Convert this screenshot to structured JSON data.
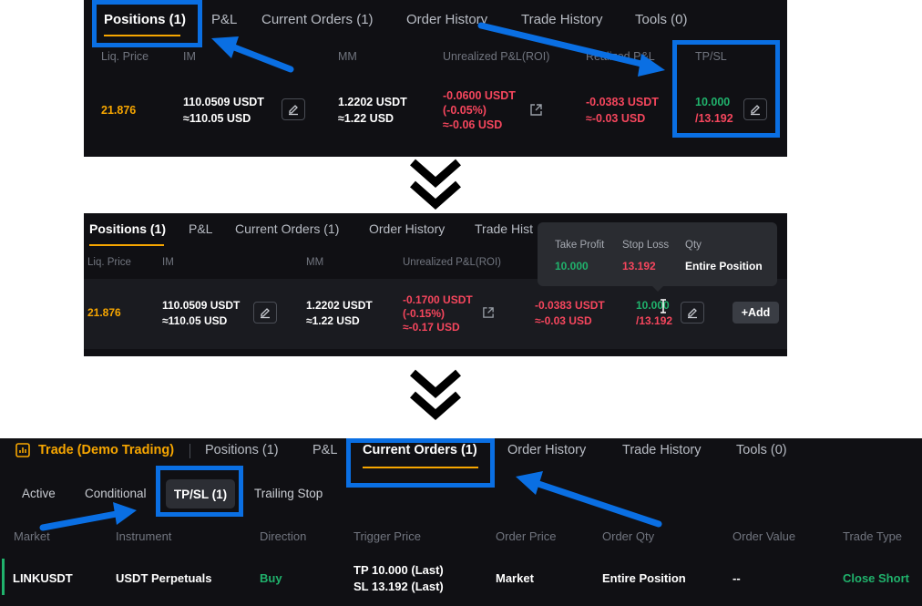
{
  "panel1": {
    "tabs": [
      "Positions (1)",
      "P&L",
      "Current Orders (1)",
      "Order History",
      "Trade History",
      "Tools (0)"
    ],
    "headers": {
      "liq": "Liq. Price",
      "im": "IM",
      "mm": "MM",
      "upnl": "Unrealized P&L(ROI)",
      "rpnl": "Realized P&L",
      "tpsl": "TP/SL"
    },
    "row": {
      "liq": "21.876",
      "im1": "110.0509 USDT",
      "im2": "≈110.05 USD",
      "mm1": "1.2202 USDT",
      "mm2": "≈1.22 USD",
      "upnl1": "-0.0600 USDT",
      "upnl2": "(-0.05%)",
      "upnl3": "≈-0.06 USD",
      "rpnl1": "-0.0383 USDT",
      "rpnl2": "≈-0.03 USD",
      "tp": "10.000",
      "sl": "/13.192"
    }
  },
  "panel2": {
    "tabs": [
      "Positions (1)",
      "P&L",
      "Current Orders (1)",
      "Order History",
      "Trade Hist"
    ],
    "headers": {
      "liq": "Liq. Price",
      "im": "IM",
      "mm": "MM",
      "upnl": "Unrealized P&L(ROI)"
    },
    "row": {
      "liq": "21.876",
      "im1": "110.0509 USDT",
      "im2": "≈110.05 USD",
      "mm1": "1.2202 USDT",
      "mm2": "≈1.22 USD",
      "upnl1": "-0.1700 USDT",
      "upnl2": "(-0.15%)",
      "upnl3": "≈-0.17 USD",
      "rpnl1": "-0.0383 USDT",
      "rpnl2": "≈-0.03 USD",
      "tp": "10.000",
      "sl": "/13.192",
      "add": "+Add"
    },
    "tooltip": {
      "h_tp": "Take Profit",
      "h_sl": "Stop Loss",
      "h_qty": "Qty",
      "tp": "10.000",
      "sl": "13.192",
      "qty": "Entire Position"
    }
  },
  "panel3": {
    "title": "Trade (Demo Trading)",
    "tabs": [
      "Positions (1)",
      "P&L",
      "Current Orders (1)",
      "Order History",
      "Trade History",
      "Tools (0)"
    ],
    "subtabs": [
      "Active",
      "Conditional",
      "TP/SL (1)",
      "Trailing Stop"
    ],
    "headers": [
      "Market",
      "Instrument",
      "Direction",
      "Trigger Price",
      "Order Price",
      "Order Qty",
      "Order Value",
      "Trade Type"
    ],
    "row": {
      "market": "LINKUSDT",
      "instrument": "USDT Perpetuals",
      "direction": "Buy",
      "trigger1": "TP 10.000 (Last)",
      "trigger2": "SL 13.192 (Last)",
      "price": "Market",
      "qty": "Entire Position",
      "value": "--",
      "type": "Close Short"
    }
  },
  "colors": {
    "accent": "#f7a600",
    "highlight": "#0a6fe3",
    "green": "#20b26c",
    "red": "#f6465d"
  },
  "icons": [
    "edit-icon",
    "share-icon",
    "chart-icon",
    "chevron-down-icon",
    "cursor-icon"
  ]
}
